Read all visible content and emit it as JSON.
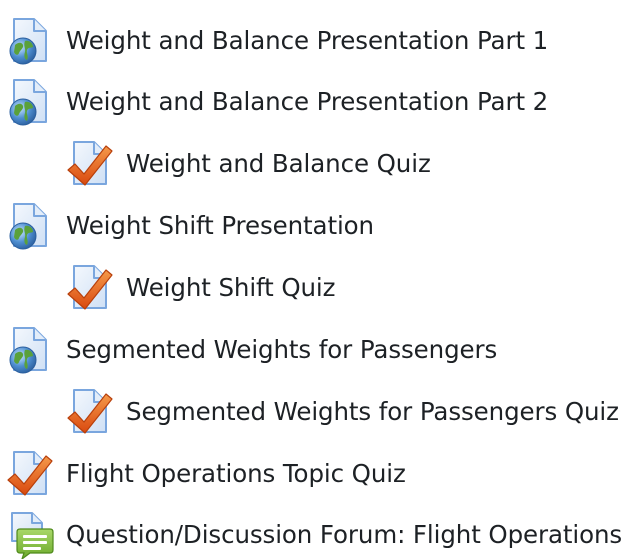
{
  "activities": [
    {
      "label": "Weight and Balance Presentation Part 1",
      "icon": "url-resource-icon"
    },
    {
      "label": "Weight and Balance Presentation Part 2",
      "icon": "url-resource-icon"
    },
    {
      "label": "Weight and Balance Quiz",
      "icon": "quiz-checkmark-icon"
    },
    {
      "label": "Weight Shift Presentation",
      "icon": "url-resource-icon"
    },
    {
      "label": "Weight Shift Quiz",
      "icon": "quiz-checkmark-icon"
    },
    {
      "label": "Segmented Weights for Passengers",
      "icon": "url-resource-icon"
    },
    {
      "label": "Segmented Weights for Passengers Quiz",
      "icon": "quiz-checkmark-icon"
    },
    {
      "label": "Flight Operations Topic Quiz",
      "icon": "quiz-checkmark-icon"
    },
    {
      "label": "Question/Discussion Forum: Flight Operations",
      "icon": "forum-icon"
    }
  ],
  "colors": {
    "text": "#1d2125",
    "page_blue": "#7aa6de",
    "globe_green": "#5aa13a",
    "check_orange": "#e8601c",
    "forum_green": "#8bc53f"
  }
}
